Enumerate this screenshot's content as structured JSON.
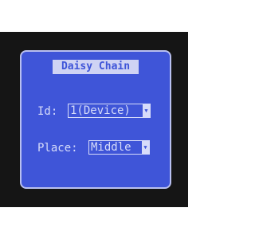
{
  "title": "Daisy Chain",
  "id_field": {
    "label": "Id:",
    "value": "1(Device)",
    "arrow": "▼"
  },
  "place_field": {
    "label": "Place:",
    "value": "Middle",
    "arrow": "▼"
  }
}
